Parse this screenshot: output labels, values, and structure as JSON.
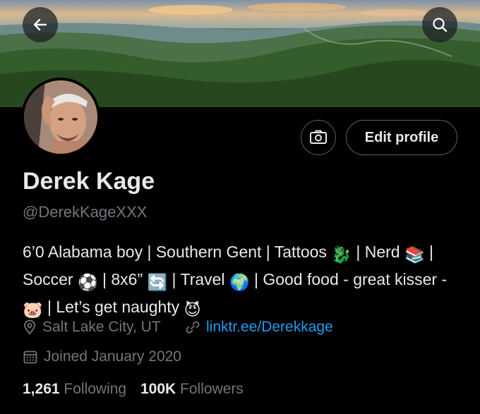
{
  "profile": {
    "name": "Derek Kage",
    "handle": "@DerekKageXXX",
    "edit_profile_label": "Edit profile",
    "bio": {
      "seg1": "6’0 Alabama boy | Southern Gent | Tattoos ",
      "seg2": " | Nerd ",
      "seg3": " | Soccer ",
      "seg4": " | 8x6” ",
      "seg5": " | Travel ",
      "seg6": " | Good food - great kisser - ",
      "seg7": " | Let’s get naughty ",
      "emoji_dragon": "🐉",
      "emoji_books": "📚",
      "emoji_soccer": "⚽",
      "emoji_repeat": "🔄",
      "emoji_globe": "🌍",
      "emoji_pig": "🐷",
      "emoji_devil": "😈"
    },
    "location": "Salt Lake City, UT",
    "website": "linktr.ee/Derekkage",
    "joined": "Joined January 2020",
    "following_count": "1,261",
    "following_label": "Following",
    "followers_count": "100K",
    "followers_label": "Followers"
  },
  "icons": {
    "back": "arrow-left-icon",
    "search": "search-icon",
    "camera": "camera-icon",
    "location": "location-pin-icon",
    "link": "link-icon",
    "calendar": "calendar-icon"
  },
  "colors": {
    "background": "#000000",
    "text_primary": "#e7e9ea",
    "text_secondary": "#71767b",
    "link": "#1d9bf0",
    "border": "#536471"
  }
}
